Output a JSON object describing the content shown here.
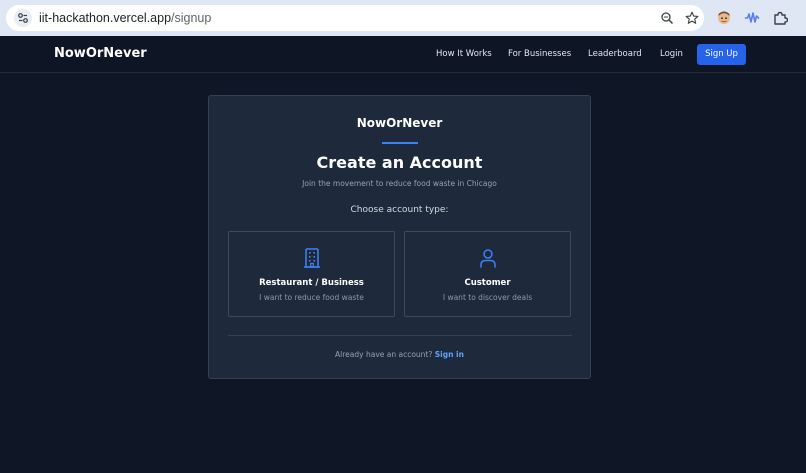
{
  "browser": {
    "url_host": "iit-hackathon.vercel.app",
    "url_path": "/signup",
    "icons": [
      "site-settings-icon",
      "zoom-icon",
      "bookmark-star-icon",
      "extension-avatar-icon",
      "extension-audio-icon",
      "extensions-puzzle-icon"
    ]
  },
  "nav": {
    "brand": "NowOrNever",
    "links": [
      "How It Works",
      "For Businesses",
      "Leaderboard",
      "Login"
    ],
    "signup_label": "Sign Up"
  },
  "card": {
    "brand": "NowOrNever",
    "title": "Create an Account",
    "subtitle": "Join the movement to reduce food waste in Chicago",
    "choose_label": "Choose account type:",
    "options": [
      {
        "icon": "building-icon",
        "title": "Restaurant / Business",
        "description": "I want to reduce food waste"
      },
      {
        "icon": "user-icon",
        "title": "Customer",
        "description": "I want to discover deals"
      }
    ],
    "footer_text": "Already have an account?",
    "signin_label": "Sign in"
  },
  "colors": {
    "page_bg": "#0f1626",
    "card_bg": "#1e293b",
    "accent": "#2563eb",
    "icon_blue": "#3b82f6",
    "link_blue": "#60a5fa"
  }
}
